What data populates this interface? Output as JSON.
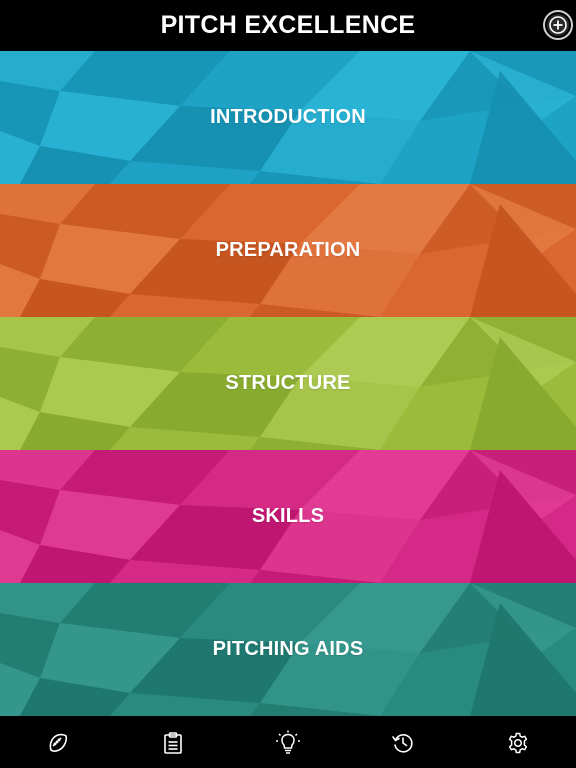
{
  "app": {
    "title": "PITCH EXCELLENCE"
  },
  "header": {
    "add_icon": "plus-circle-icon"
  },
  "sections": [
    {
      "label": "INTRODUCTION",
      "color": "#1ea3c6",
      "shade": "#168fb0",
      "light": "#2bb4d6"
    },
    {
      "label": "PREPARATION",
      "color": "#d9672f",
      "shade": "#c4531f",
      "light": "#e47c45"
    },
    {
      "label": "STRUCTURE",
      "color": "#9bbb3c",
      "shade": "#86a82e",
      "light": "#afcb55"
    },
    {
      "label": "SKILLS",
      "color": "#d42a86",
      "shade": "#bd156f",
      "light": "#e23e96"
    },
    {
      "label": "PITCHING AIDS",
      "color": "#2a8a80",
      "shade": "#1f776d",
      "light": "#389a90"
    }
  ],
  "tabbar": {
    "tabs": [
      {
        "icon": "rugby-ball-icon"
      },
      {
        "icon": "clipboard-icon"
      },
      {
        "icon": "lightbulb-icon"
      },
      {
        "icon": "history-icon"
      },
      {
        "icon": "settings-icon"
      }
    ]
  }
}
